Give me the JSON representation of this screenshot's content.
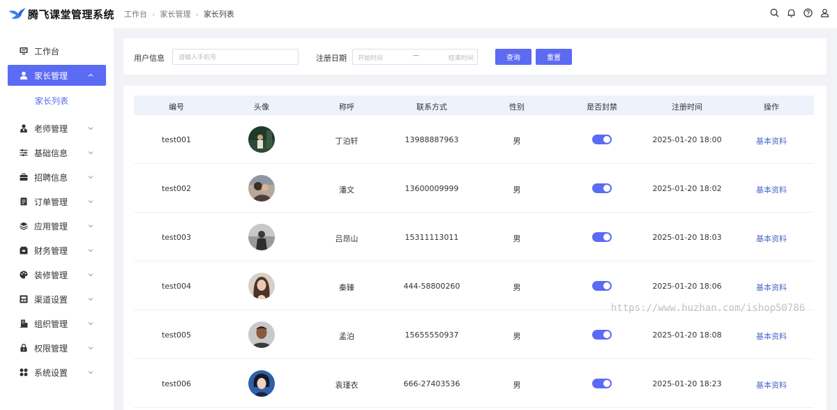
{
  "app": {
    "title": "腾飞课堂管理系统"
  },
  "breadcrumb": [
    "工作台",
    "家长管理",
    "家长列表"
  ],
  "header_icons": [
    "search-icon",
    "bell-icon",
    "help-icon",
    "user-icon"
  ],
  "sidebar": {
    "items": [
      {
        "label": "工作台",
        "icon": "monitor-icon"
      },
      {
        "label": "家长管理",
        "icon": "person-icon",
        "active": true,
        "expanded": true
      },
      {
        "label": "老师管理",
        "icon": "teacher-icon"
      },
      {
        "label": "基础信息",
        "icon": "sliders-icon"
      },
      {
        "label": "招聘信息",
        "icon": "briefcase-icon"
      },
      {
        "label": "订单管理",
        "icon": "order-icon"
      },
      {
        "label": "应用管理",
        "icon": "layers-icon"
      },
      {
        "label": "财务管理",
        "icon": "wallet-icon"
      },
      {
        "label": "装修管理",
        "icon": "palette-icon"
      },
      {
        "label": "渠道设置",
        "icon": "channel-icon"
      },
      {
        "label": "组织管理",
        "icon": "org-icon"
      },
      {
        "label": "权限管理",
        "icon": "lock-icon"
      },
      {
        "label": "系统设置",
        "icon": "grid-icon"
      }
    ],
    "subitem": "家长列表"
  },
  "filter": {
    "user_label": "用户信息",
    "user_placeholder": "请输入手机号",
    "date_label": "注册日期",
    "date_start_placeholder": "开始时间",
    "date_separator": "—",
    "date_end_placeholder": "结束时间",
    "query_label": "查询",
    "reset_label": "重置"
  },
  "table": {
    "columns": [
      "编号",
      "头像",
      "称呼",
      "联系方式",
      "性别",
      "是否封禁",
      "注册时间",
      "操作"
    ],
    "rows": [
      {
        "id": "test001",
        "name": "丁泊轩",
        "phone": "13988887963",
        "gender": "男",
        "banned": true,
        "registered": "2025-01-20  18:00",
        "action": "基本资料"
      },
      {
        "id": "test002",
        "name": "潘文",
        "phone": "13600009999",
        "gender": "男",
        "banned": true,
        "registered": "2025-01-20  18:02",
        "action": "基本资料"
      },
      {
        "id": "test003",
        "name": "吕昂山",
        "phone": "15311113011",
        "gender": "男",
        "banned": true,
        "registered": "2025-01-20  18:03",
        "action": "基本资料"
      },
      {
        "id": "test004",
        "name": "秦臻",
        "phone": "444-58800260",
        "gender": "男",
        "banned": true,
        "registered": "2025-01-20  18:06",
        "action": "基本资料"
      },
      {
        "id": "test005",
        "name": "孟泊",
        "phone": "15655550937",
        "gender": "男",
        "banned": true,
        "registered": "2025-01-20  18:08",
        "action": "基本资料"
      },
      {
        "id": "test006",
        "name": "袁瑾衣",
        "phone": "666-27403536",
        "gender": "男",
        "banned": true,
        "registered": "2025-01-20  18:23",
        "action": "基本资料"
      }
    ]
  },
  "watermark": "https://www.huzhan.com/ishop50786",
  "colors": {
    "accent": "#5b6bf3",
    "link": "#4a67c8",
    "header_row": "#eef2fb",
    "page_bg": "#f2f3f7"
  }
}
